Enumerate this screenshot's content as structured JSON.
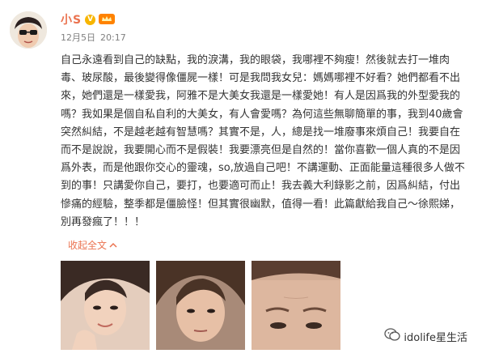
{
  "post": {
    "username": "小S",
    "verified_badge": "V",
    "date": "12月5日",
    "time": "20:17",
    "body": "自己永遠看到自己的缺點，我的淚溝，我的眼袋，我哪裡不夠瘦！然後就去打一堆肉毒、玻尿酸，最後變得像僵屍一樣！可是我問我女兒：媽媽哪裡不好看？她們都看不出來，她們還是一樣愛我，阿雅不是大美女我還是一樣愛她！有人是因爲我的外型愛我的嗎？我如果是個自私自利的大美女，有人會愛嗎？為何這些無聊簡單的事，我到40歲會突然糾結，不是越老越有智慧嗎？其實不是，人，總是找一堆廢事來煩自己！我要自在而不是說說，我要開心而不是假裝！我要漂亮但是自然的！當你喜歡一個人真的不是因爲外表，而是他跟你交心的靈魂，so,放過自己吧！不講運動、正面能量這種很多人做不到的事！只講愛你自己，要打，也要適可而止！我去義大利錄影之前，因爲糾結，付出慘痛的經驗，整季都是僵臉怪！但其實很幽默，值得一看！此篇獻給我自己～徐熙娣，別再發瘋了！！！",
    "collapse_label": "收起全文"
  },
  "icons": {
    "avatar": "avatar-photo",
    "member": "member-crown-icon",
    "collapse": "chevron-up-icon",
    "watermark": "wechat-icon"
  },
  "photos": [
    {
      "name": "photo-1"
    },
    {
      "name": "photo-2"
    },
    {
      "name": "photo-3"
    }
  ],
  "watermark": {
    "text": "idolife星生活"
  },
  "colors": {
    "accent": "#eb7350",
    "text": "#333333",
    "meta": "#808080",
    "badge": "#f7b500"
  }
}
